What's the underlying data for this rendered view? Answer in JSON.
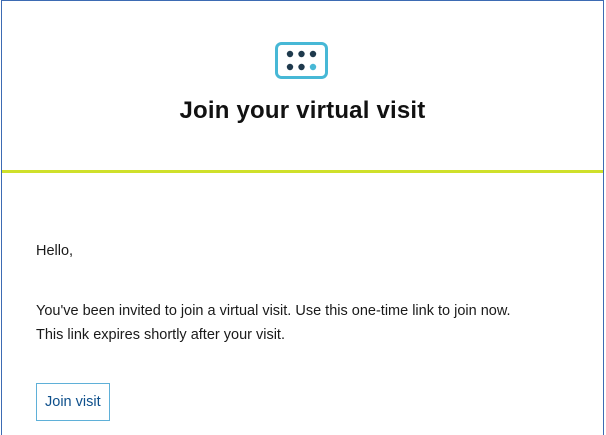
{
  "header": {
    "logo_icon": "nine-dot-grid-icon",
    "title": "Join your virtual visit"
  },
  "body": {
    "greeting": "Hello,",
    "message_line1": "You've been invited to join a virtual visit. Use this one-time link to join now.",
    "message_line2": "This link expires shortly after your visit."
  },
  "actions": {
    "join_label": "Join visit"
  },
  "colors": {
    "accent_line": "#cfe02a",
    "logo_border": "#47b8d6",
    "logo_dots": "#1f3a4d",
    "logo_highlight_dot": "#47b8d6",
    "button_border": "#5fb0d8",
    "button_text": "#0d4f8b",
    "frame_border": "#3d6bb3"
  }
}
